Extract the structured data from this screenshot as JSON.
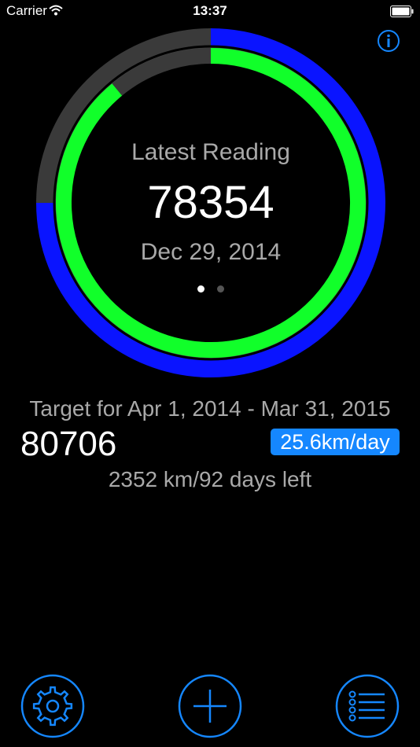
{
  "status_bar": {
    "carrier": "Carrier",
    "time": "13:37",
    "wifi_icon": "wifi-icon",
    "battery_icon": "battery-icon"
  },
  "header": {
    "info_icon": "info-icon"
  },
  "gauge": {
    "label": "Latest Reading",
    "value": "78354",
    "date": "Dec 29, 2014",
    "outer_progress": 0.75,
    "inner_progress": 0.89,
    "colors": {
      "outer_fill": "#0a14ff",
      "inner_fill": "#11ff2a",
      "track": "#3a3a3a",
      "background": "#000000"
    }
  },
  "pager": {
    "pages": 2,
    "current": 1
  },
  "target": {
    "label": "Target for Apr 1, 2014 - Mar 31, 2015",
    "value": "80706",
    "rate": "25.6km/day",
    "remaining": "2352 km/92 days left"
  },
  "toolbar": {
    "accent": "#1587ff",
    "items": [
      {
        "icon": "gear-icon"
      },
      {
        "icon": "plus-icon"
      },
      {
        "icon": "list-icon"
      }
    ]
  }
}
